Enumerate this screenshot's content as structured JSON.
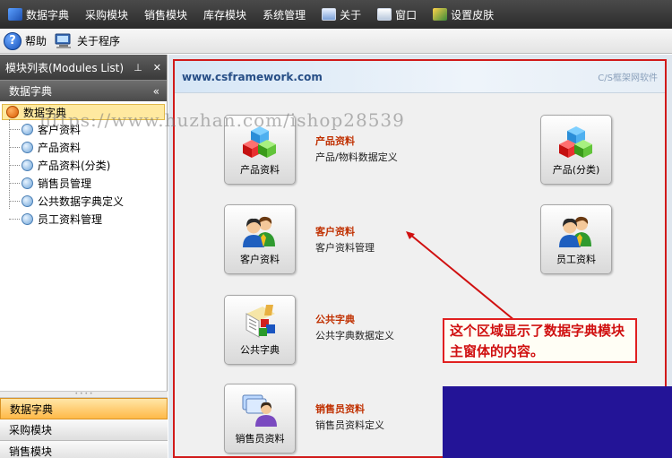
{
  "menubar": {
    "items": [
      {
        "label": "数据字典"
      },
      {
        "label": "采购模块"
      },
      {
        "label": "销售模块"
      },
      {
        "label": "库存模块"
      },
      {
        "label": "系统管理"
      },
      {
        "label": "关于"
      },
      {
        "label": "窗口"
      },
      {
        "label": "设置皮肤"
      }
    ]
  },
  "toolbar": {
    "help_label": "帮助",
    "about_label": "关于程序"
  },
  "left_panel": {
    "title": "模块列表(Modules List)",
    "pin_icon": "pin-icon",
    "close_icon": "close-icon",
    "group_header": "数据字典",
    "tree": {
      "root": "数据字典",
      "children": [
        "客户资料",
        "产品资料",
        "产品资料(分类)",
        "销售员管理",
        "公共数据字典定义",
        "员工资料管理"
      ]
    },
    "nav_buttons": [
      "数据字典",
      "采购模块",
      "销售模块"
    ]
  },
  "main": {
    "banner_url": "www.csframework.com",
    "banner_right": "C/S框架网软件",
    "tiles": {
      "product": "产品资料",
      "product_category": "产品(分类)",
      "customer": "客户资料",
      "employee": "员工资料",
      "common_dict": "公共字典",
      "sales_rep": "销售员资料"
    },
    "entries": [
      {
        "title": "产品资料",
        "desc": "产品/物料数据定义"
      },
      {
        "title": "客户资料",
        "desc": "客户资料管理"
      },
      {
        "title": "公共字典",
        "desc": "公共字典数据定义"
      },
      {
        "title": "销售员资料",
        "desc": "销售员资料定义"
      }
    ],
    "annotation": "这个区域显示了数据字典模块主窗体的内容。"
  },
  "watermark": "https://www.huzhan.com/ishop28539",
  "colors": {
    "accent_red": "#d11a1a",
    "menubar_dark": "#2b2b2b",
    "active_orange": "#ffb948",
    "title_red": "#c03000"
  }
}
